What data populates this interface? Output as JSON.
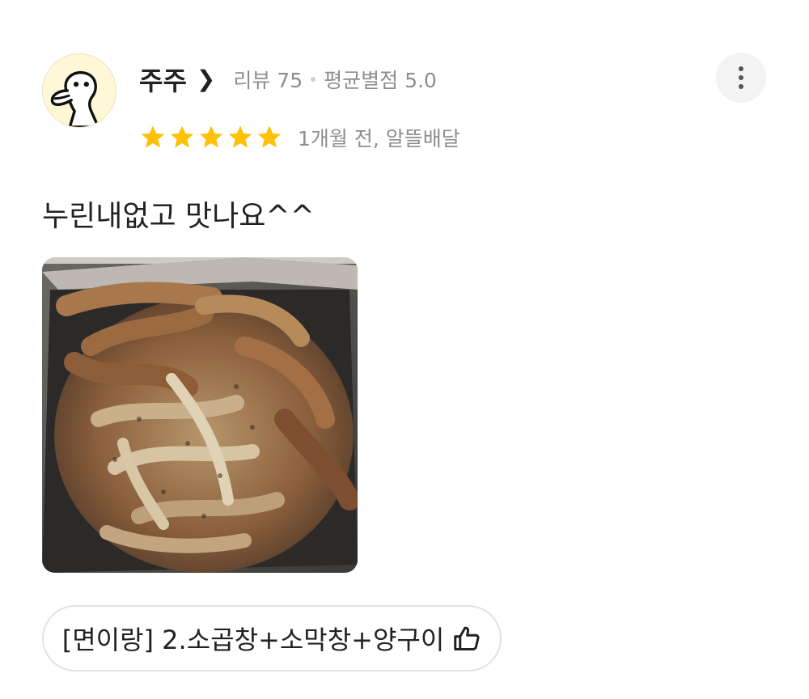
{
  "review": {
    "user": {
      "name": "주주",
      "review_label": "리뷰 75",
      "avg_rating_label": "평균별점 5.0"
    },
    "rating": 5,
    "date_label": "1개월 전, 알뜰배달",
    "text": "누린내없고 맛나요^^",
    "menu_tag": "[면이랑] 2.소곱창+소막창+양구이"
  },
  "icons": {
    "user_chevron": "chevron-right-icon",
    "more": "more-vertical-icon",
    "star": "star-icon",
    "thumb": "thumbs-up-icon"
  },
  "colors": {
    "star": "#FFC107",
    "meta_text": "#8E8E8E",
    "chip_border": "#E2E2E2"
  }
}
